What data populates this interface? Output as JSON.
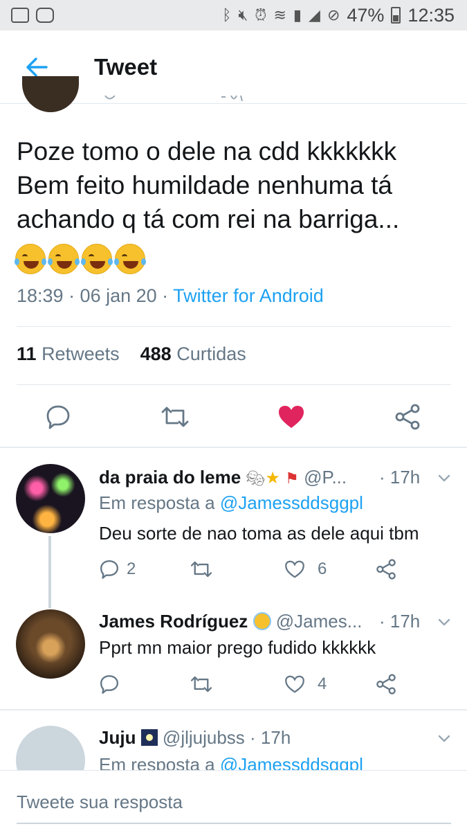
{
  "status_bar": {
    "battery": "47%",
    "time": "12:35",
    "icons": [
      "notification-icon",
      "instagram-icon",
      "bluetooth-icon",
      "mute-icon",
      "alarm-icon",
      "wifi-icon",
      "sim-icon",
      "signal-icon",
      "block-icon",
      "battery-icon"
    ]
  },
  "header": {
    "title": "Tweet"
  },
  "tweet": {
    "text_line1": "Poze tomo o dele na cdd kkkkkkk",
    "text_line2": "Bem feito  humildade nenhuma tá",
    "text_line3": "achando q tá com rei na barriga...",
    "time": "18:39 · 06 jan 20 · ",
    "source": "Twitter for Android",
    "retweets_count": "11",
    "retweets_label": "Retweets",
    "likes_count": "488",
    "likes_label": "Curtidas",
    "liked_color": "#e0245e"
  },
  "replies": [
    {
      "name": "da praia do leme",
      "handle": "@P...",
      "time": "· 17h",
      "in_reply_prefix": "Em resposta a ",
      "in_reply_handle": "@Jamessddsggpl",
      "text": "Deu sorte de nao toma as dele aqui tbm",
      "reply_count": "2",
      "like_count": "6"
    },
    {
      "name": "James Rodríguez",
      "handle": "@James...",
      "time": "· 17h",
      "text": "Pprt mn maior prego fudido kkkkkk",
      "like_count": "4"
    },
    {
      "name": "Juju",
      "handle": "@jljujubss",
      "time": "· 17h",
      "in_reply_prefix": "Em resposta a ",
      "in_reply_handle": "@Jamessddsggpl"
    }
  ],
  "composer": {
    "placeholder": "Tweete sua resposta"
  }
}
